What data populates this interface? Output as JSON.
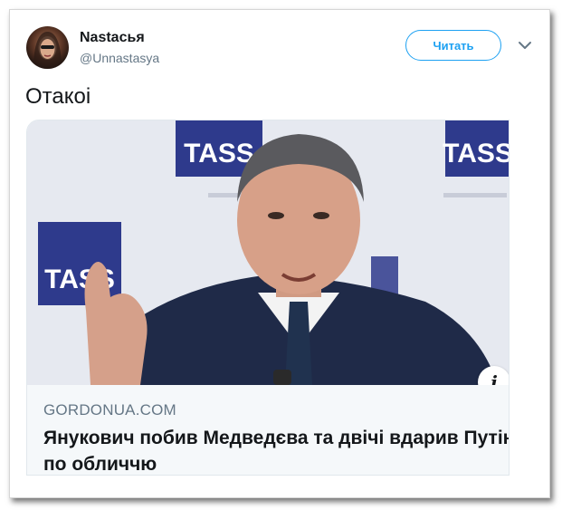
{
  "tweet": {
    "author": {
      "display_name": "Nastасья",
      "username": "@Unnastasya"
    },
    "follow_label": "Читать",
    "menu_icon": "chevron-down-icon",
    "text": "Отакоі"
  },
  "card": {
    "domain": "GORDONUA.COM",
    "title": "Янукович побив Медведєва та двічі вдарив Путіна по обличчю",
    "info_icon_glyph": "i",
    "image_logo_text": "TASS"
  },
  "colors": {
    "accent": "#1da1f2",
    "text": "#14171a",
    "secondary": "#657786",
    "card_footer_bg": "#f5f8fa"
  }
}
